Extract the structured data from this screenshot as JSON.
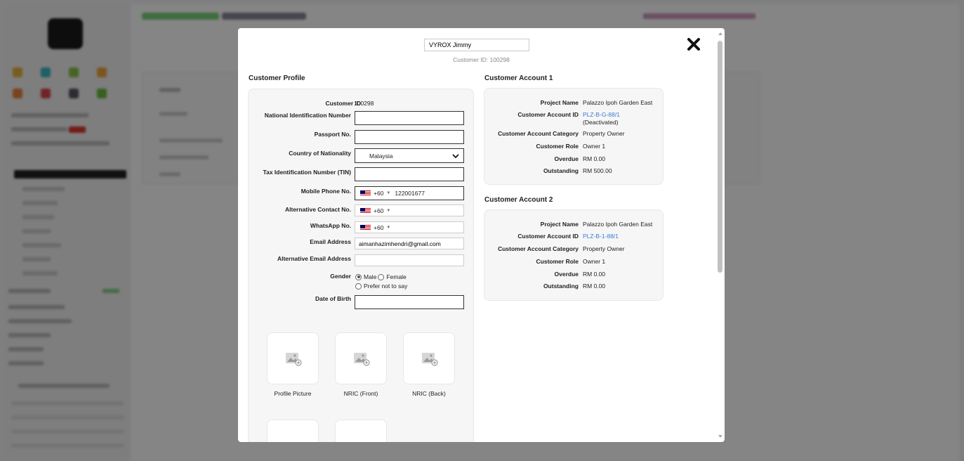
{
  "modal": {
    "customer_name": "VYROX Jimmy",
    "customer_id_line": "Customer ID: 100298",
    "close_icon": "close-icon"
  },
  "profile": {
    "title": "Customer Profile",
    "customer_id_label": "Customer ID",
    "customer_id_value": "100298",
    "nin_label": "National Identification Number",
    "nin_value": "",
    "passport_label": "Passport No.",
    "passport_value": "",
    "nationality_label": "Country of Nationality",
    "nationality_value": "Malaysia",
    "tin_label": "Tax Identification Number (TIN)",
    "tin_value": "",
    "mobile_label": "Mobile Phone No.",
    "mobile_code": "+60",
    "mobile_value": "122001677",
    "alt_contact_label": "Alternative Contact No.",
    "alt_contact_code": "+60",
    "whatsapp_label": "WhatsApp No.",
    "whatsapp_code": "+60",
    "email_label": "Email Address",
    "email_value": "aimanhazimhendri@gmail.com",
    "alt_email_label": "Alternative Email Address",
    "alt_email_value": "",
    "gender_label": "Gender",
    "gender_options": [
      "Male",
      "Female",
      "Prefer not to say"
    ],
    "gender_selected": "Male",
    "dob_label": "Date of Birth",
    "dob_value": "",
    "uploads": [
      "Profile Picture",
      "NRIC (Front)",
      "NRIC (Back)"
    ]
  },
  "accounts": [
    {
      "title": "Customer Account 1",
      "project_name_label": "Project Name",
      "project_name": "Palazzo Ipoh Garden East",
      "account_id_label": "Customer Account ID",
      "account_id": "PLZ-B-G-88/1",
      "account_status": "(Deactivated)",
      "category_label": "Customer Account Category",
      "category": "Property Owner",
      "role_label": "Customer Role",
      "role": "Owner 1",
      "overdue_label": "Overdue",
      "overdue": "RM 0.00",
      "outstanding_label": "Outstanding",
      "outstanding": "RM 500.00"
    },
    {
      "title": "Customer Account 2",
      "project_name_label": "Project Name",
      "project_name": "Palazzo Ipoh Garden East",
      "account_id_label": "Customer Account ID",
      "account_id": "PLZ-B-1-88/1",
      "category_label": "Customer Account Category",
      "category": "Property Owner",
      "role_label": "Customer Role",
      "role": "Owner 1",
      "overdue_label": "Overdue",
      "overdue": "RM 0.00",
      "outstanding_label": "Outstanding",
      "outstanding": "RM 0.00"
    }
  ],
  "colors": {
    "link": "#3a7bd5",
    "overlay": "rgba(0,0,0,0.48)",
    "panel_bg": "#f6f6f6"
  }
}
